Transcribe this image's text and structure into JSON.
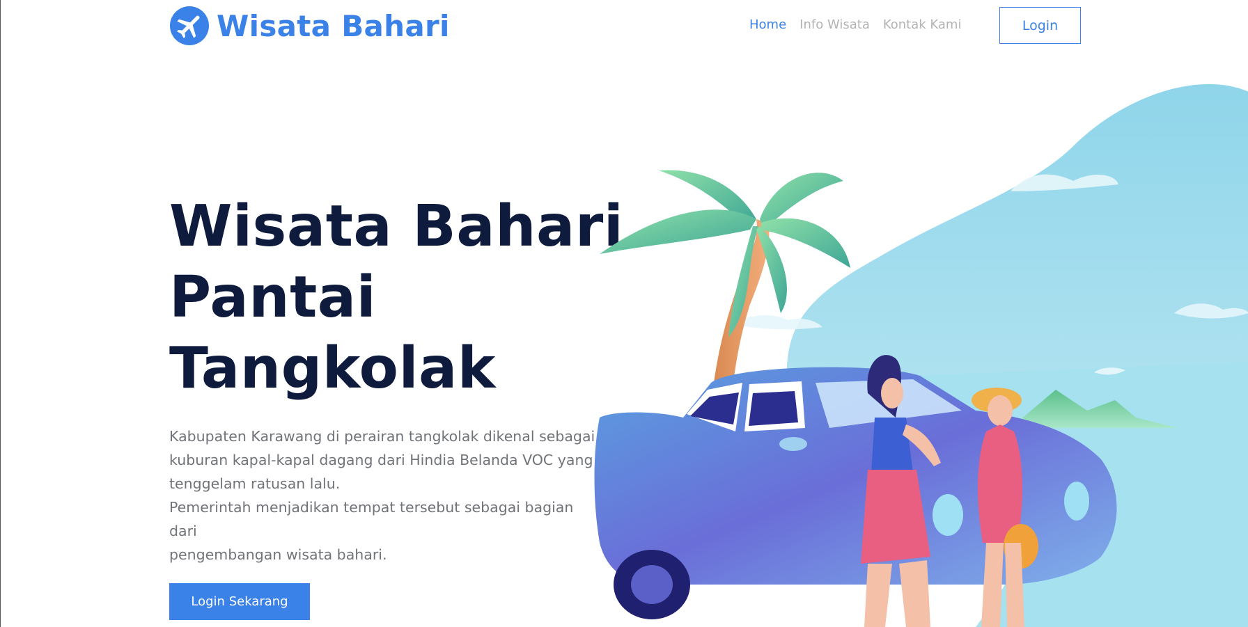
{
  "brand": {
    "name": "Wisata Bahari",
    "color": "#3b82e8",
    "icon": "airplane-icon"
  },
  "nav": {
    "items": [
      {
        "label": "Home",
        "active": true
      },
      {
        "label": "Info Wisata",
        "active": false
      },
      {
        "label": "Kontak Kami",
        "active": false
      }
    ],
    "login_label": "Login"
  },
  "hero": {
    "title_lines": [
      "Wisata Bahari",
      "Pantai",
      "Tangkolak"
    ],
    "description_lines": [
      "Kabupaten Karawang di perairan tangkolak dikenal sebagai",
      "kuburan kapal-kapal dagang dari Hindia Belanda VOC yang",
      "tenggelam ratusan lalu.",
      "Pemerintah menjadikan tempat tersebut sebagai bagian dari",
      "pengembangan wisata bahari."
    ],
    "cta_label": "Login Sekarang"
  },
  "colors": {
    "accent": "#3b82e8",
    "heading": "#0e1b3d",
    "body_text": "#707378",
    "nav_inactive": "#b3b3b3"
  },
  "illustration": {
    "subject": "beach-illustration"
  }
}
